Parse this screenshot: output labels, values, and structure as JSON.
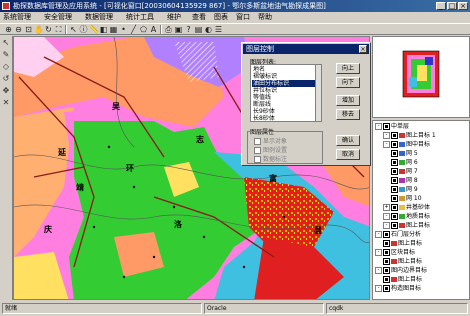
{
  "window": {
    "title": "勘探数据库管理及应用系统 - [可视化窗口[20030604135929 867] - 鄂尔多斯盆地油气勘探成果图]",
    "controls": [
      "_",
      "□",
      "×"
    ]
  },
  "menu": [
    "系统管理",
    "安全管理",
    "数据管理",
    "统计工具",
    "维护",
    "查看",
    "图表",
    "窗口",
    "帮助"
  ],
  "map": {
    "labels": [
      "吴",
      "延",
      "靖",
      "环",
      "庆",
      "富",
      "县",
      "志",
      "洛"
    ],
    "colors": {
      "pink": "#ff7fe0",
      "green": "#33cc33",
      "orange": "#ff9966",
      "red": "#e02020",
      "cyan": "#40c0e0",
      "yellow": "#ffe060",
      "purple": "#b080ff"
    }
  },
  "dialog": {
    "title": "图层控制",
    "list_label": "图层列表:",
    "items": [
      "地名",
      "褶皱标识",
      "油田分布标识",
      "井位标识",
      "等值线",
      "断层线",
      "长9砂体",
      "长8砂体",
      "长6砂体",
      "边界线",
      "省界",
      "等高线标注",
      "构造线"
    ],
    "selected_index": 2,
    "buttons": {
      "up": "向上",
      "down": "向下",
      "add": "增加",
      "remove": "移去",
      "ok": "确认",
      "cancel": "取消"
    },
    "props_label": "图层属性",
    "props": [
      "显示对象",
      "图例设置",
      "数据标注"
    ]
  },
  "tree": {
    "items": [
      {
        "label": "中单层",
        "level": 0,
        "checked": true,
        "toggle": "-"
      },
      {
        "label": "图上目标 1",
        "level": 1,
        "checked": true,
        "toggle": "-",
        "swatch": "#cc3333"
      },
      {
        "label": "图中目标",
        "level": 1,
        "checked": true,
        "toggle": "-",
        "swatch": "#3366cc"
      },
      {
        "label": "网 5",
        "level": 2,
        "checked": true,
        "swatch": "#3366cc"
      },
      {
        "label": "网 6",
        "level": 2,
        "checked": true,
        "swatch": "#33aa33"
      },
      {
        "label": "网 7",
        "level": 2,
        "checked": true,
        "swatch": "#cc3333"
      },
      {
        "label": "网 8",
        "level": 2,
        "checked": true,
        "swatch": "#aa33aa"
      },
      {
        "label": "网 9",
        "level": 2,
        "checked": true,
        "swatch": "#3399cc"
      },
      {
        "label": "网 10",
        "level": 2,
        "checked": true,
        "swatch": "#cc9933"
      },
      {
        "label": "井基砂体",
        "level": 1,
        "checked": true,
        "toggle": "+",
        "swatch": "#e8c040"
      },
      {
        "label": "地质目标",
        "level": 1,
        "checked": true,
        "toggle": "-",
        "swatch": "#33aa33"
      },
      {
        "label": "图上目标",
        "level": 1,
        "checked": true,
        "toggle": "-",
        "swatch": "#cc3333"
      },
      {
        "label": "石门层分析",
        "level": 0,
        "checked": true,
        "toggle": "-"
      },
      {
        "label": "图上目标",
        "level": 1,
        "checked": true,
        "swatch": "#cc3333"
      },
      {
        "label": "区块目标",
        "level": 0,
        "checked": true,
        "toggle": "-"
      },
      {
        "label": "图上目标",
        "level": 1,
        "checked": true,
        "swatch": "#cc3333"
      },
      {
        "label": "图内边界目标",
        "level": 0,
        "checked": true,
        "toggle": "-"
      },
      {
        "label": "图上目标",
        "level": 1,
        "checked": true,
        "swatch": "#cc3333"
      },
      {
        "label": "构造图目标",
        "level": 0,
        "checked": true,
        "toggle": "-"
      }
    ]
  },
  "status": {
    "ready": "就绪",
    "db": "Oracle",
    "user": "cqdk"
  }
}
